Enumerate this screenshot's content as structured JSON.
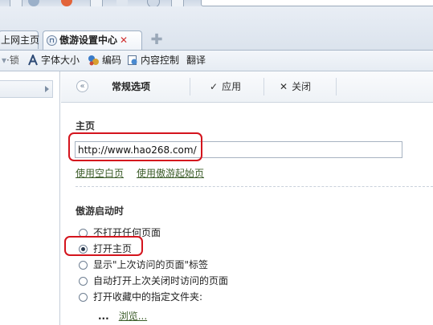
{
  "tabs": [
    {
      "label": "上网主页",
      "active": false
    },
    {
      "label": "傲游设置中心",
      "active": true
    }
  ],
  "toolbar": {
    "items": [
      {
        "label": "字体大小",
        "icon": "font-size-icon"
      },
      {
        "label": "编码",
        "icon": "encoding-icon"
      },
      {
        "label": "内容控制",
        "icon": "content-control-icon"
      },
      {
        "label": "翻译",
        "icon": ""
      }
    ],
    "truncated_left": "·锁"
  },
  "settings_header": {
    "title": "常规选项",
    "apply_label": "应用",
    "close_label": "关闭"
  },
  "homepage": {
    "section_title": "主页",
    "url_value": "http://www.hao268.com/",
    "use_blank_label": "使用空白页",
    "use_maxthon_start_label": "使用傲游起始页"
  },
  "startup": {
    "section_title": "傲游启动时",
    "options": [
      {
        "label": "不打开任何页面",
        "checked": false
      },
      {
        "label": "打开主页",
        "checked": true
      },
      {
        "label": "显示\"上次访问的页面\"标签",
        "checked": false
      },
      {
        "label": "自动打开上次关闭时访问的页面",
        "checked": false
      },
      {
        "label": "打开收藏中的指定文件夹:",
        "checked": false
      }
    ],
    "folder_value": "...",
    "browse_label": "浏览..."
  },
  "colors": {
    "highlight": "#d4141d",
    "link": "#3c5d2a",
    "tab_close": "#d03030"
  }
}
